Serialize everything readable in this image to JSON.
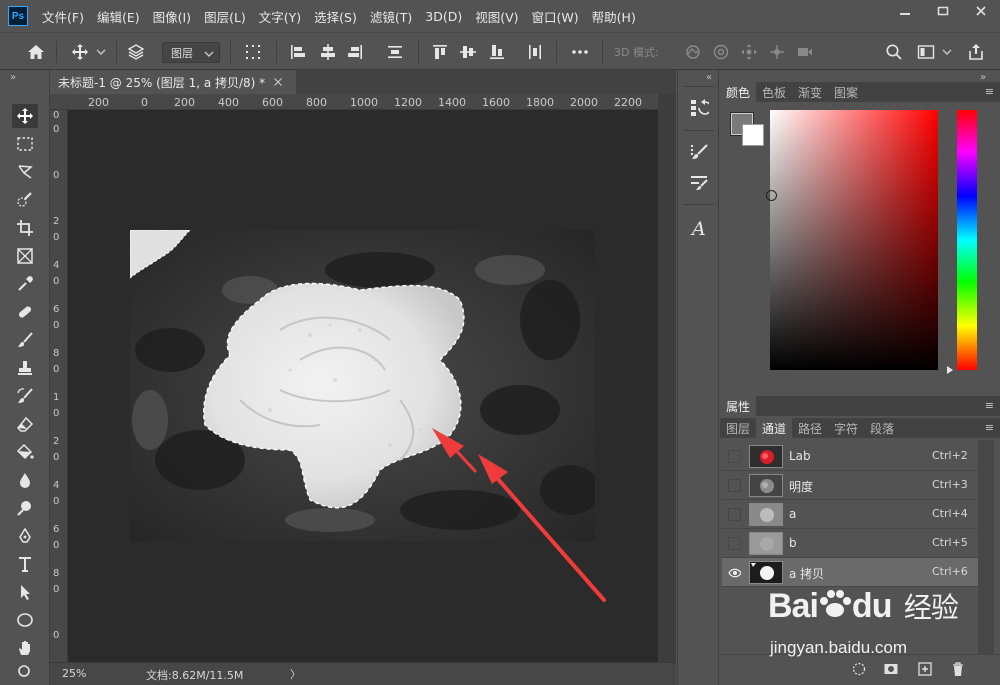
{
  "app": {
    "logo_text": "Ps"
  },
  "menu": [
    "文件(F)",
    "编辑(E)",
    "图像(I)",
    "图层(L)",
    "文字(Y)",
    "选择(S)",
    "滤镜(T)",
    "3D(D)",
    "视图(V)",
    "窗口(W)",
    "帮助(H)"
  ],
  "options_bar": {
    "layer_select_value": "图层",
    "mode_3d_label": "3D 模式:"
  },
  "document": {
    "tab_title": "未标题-1 @ 25% (图层 1, a 拷贝/8) *",
    "ruler_top_ticks": [
      "200",
      "0",
      "200",
      "400",
      "600",
      "800",
      "1000",
      "1200",
      "1400",
      "1600",
      "1800",
      "2000",
      "2200"
    ],
    "ruler_left_ticks": [
      "0",
      "0",
      "0",
      "2",
      "0",
      "4",
      "0",
      "6",
      "0",
      "8",
      "0",
      "1",
      "0",
      "2",
      "0",
      "4",
      "0",
      "6",
      "0",
      "8",
      "0",
      "0"
    ]
  },
  "status": {
    "zoom": "25%",
    "doc_info": "文档:8.62M/11.5M",
    "arrow": "〉"
  },
  "color_panel": {
    "tabs": [
      "颜色",
      "色板",
      "渐变",
      "图案"
    ],
    "active_tab": 0,
    "fg_color": "#7a7a7a",
    "bg_color": "#ffffff"
  },
  "properties_panel": {
    "title": "属性"
  },
  "channels_panel": {
    "tabs": [
      "图层",
      "通道",
      "路径",
      "字符",
      "段落"
    ],
    "active_tab": 1,
    "channels": [
      {
        "name": "Lab",
        "shortcut": "Ctrl+2",
        "visible": false,
        "selected": false
      },
      {
        "name": "明度",
        "shortcut": "Ctrl+3",
        "visible": false,
        "selected": false
      },
      {
        "name": "a",
        "shortcut": "Ctrl+4",
        "visible": false,
        "selected": false
      },
      {
        "name": "b",
        "shortcut": "Ctrl+5",
        "visible": false,
        "selected": false
      },
      {
        "name": "a 拷贝",
        "shortcut": "Ctrl+6",
        "visible": true,
        "selected": true
      }
    ]
  },
  "watermark": {
    "brand_left": "Bai",
    "brand_right": "du",
    "suffix": "经验",
    "url": "jingyan.baidu.com"
  },
  "colors": {
    "annotation_arrow": "#ee3b3b"
  }
}
